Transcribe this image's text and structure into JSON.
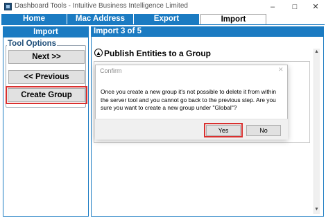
{
  "window": {
    "title": "Dashboard Tools - Intuitive Business Intelligence Limited",
    "controls": {
      "minimize": "–",
      "maximize": "□",
      "close": "✕"
    }
  },
  "tabs": [
    {
      "label": "Home",
      "active": false
    },
    {
      "label": "Mac Address",
      "active": false
    },
    {
      "label": "Export",
      "active": false
    },
    {
      "label": "Import",
      "active": true
    }
  ],
  "left_panel": {
    "header": "Import",
    "group_label": "Tool Options",
    "buttons": {
      "next": "Next >>",
      "previous": "<< Previous",
      "create_group": "Create Group"
    }
  },
  "right_panel": {
    "header": "Import 3 of 5",
    "section_title": "Publish Entities to a Group",
    "section_icon": "chevron-up-circle-icon"
  },
  "dialog": {
    "title": "Confirm",
    "close_glyph": "✕",
    "message": "Once you create a new group it's not possible to delete it from within the server tool and you cannot go back to the previous step. Are you sure you want to create a new group under \"Global\"?",
    "buttons": {
      "yes": "Yes",
      "no": "No"
    }
  },
  "colors": {
    "accent": "#1b7bc2",
    "highlight": "#d9302f",
    "header_text": "#ffffff"
  }
}
